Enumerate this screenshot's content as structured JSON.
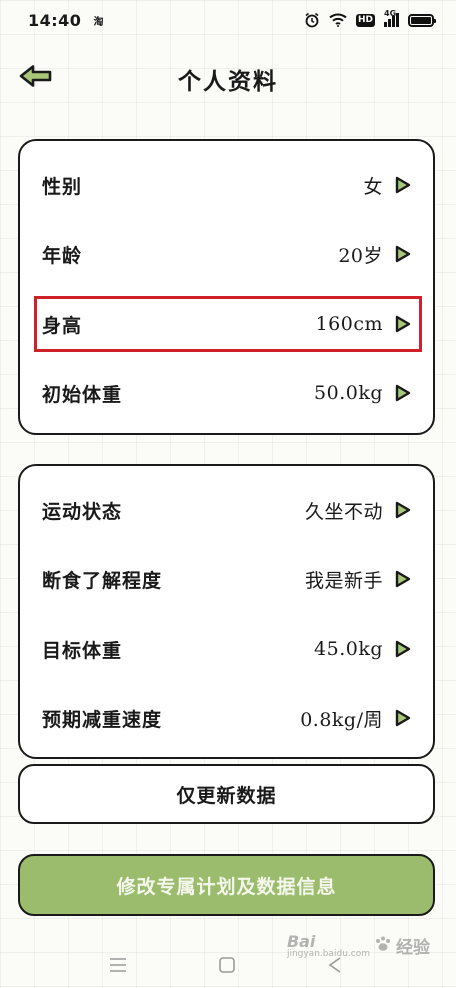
{
  "status_bar": {
    "time": "14:40",
    "app_indicator": "淘",
    "network_label": "HD",
    "signal_label": "4G",
    "icons": [
      "alarm-icon",
      "wifi-icon",
      "hd-icon",
      "signal-icon",
      "battery-icon"
    ]
  },
  "header": {
    "title": "个人资料",
    "back_icon": "arrow-left-icon"
  },
  "profile_basic": [
    {
      "label": "性别",
      "value": "女"
    },
    {
      "label": "年龄",
      "value": "20岁"
    },
    {
      "label": "身高",
      "value": "160cm"
    },
    {
      "label": "初始体重",
      "value": "50.0kg"
    }
  ],
  "profile_goals": [
    {
      "label": "运动状态",
      "value": "久坐不动"
    },
    {
      "label": "断食了解程度",
      "value": "我是新手"
    },
    {
      "label": "目标体重",
      "value": "45.0kg"
    },
    {
      "label": "预期减重速度",
      "value": "0.8kg/周"
    }
  ],
  "buttons": {
    "update_only": "仅更新数据",
    "update_plan": "修改专属计划及数据信息"
  },
  "watermark": {
    "brand": "Bai",
    "brand_suffix": "经验",
    "sub": "jingyan.baidu.com"
  },
  "colors": {
    "accent_green": "#9bbc6c",
    "arrow_fill": "#a9c77a",
    "highlight_red": "#d0202a",
    "outline": "#1a1a1a"
  }
}
